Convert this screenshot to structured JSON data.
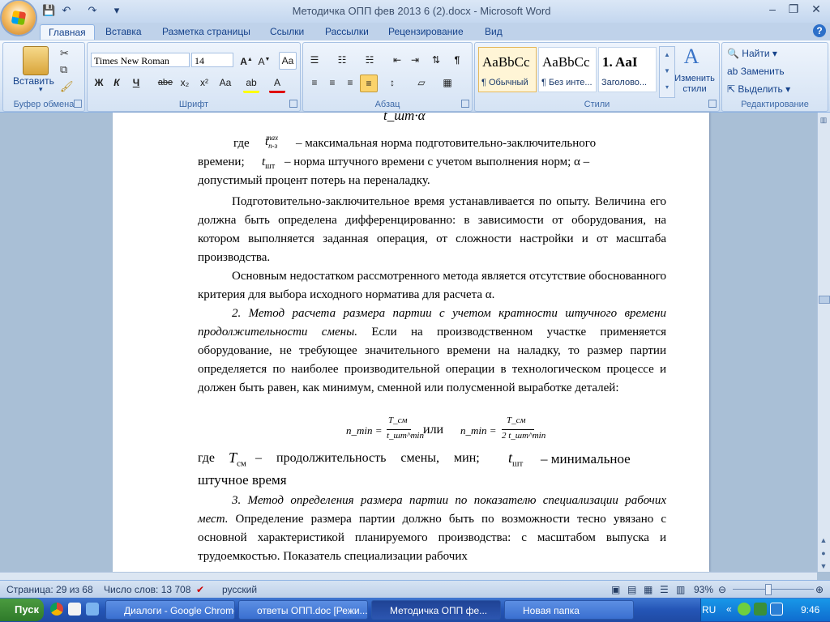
{
  "window": {
    "title": "Методичка ОПП фев 2013 6 (2).docx - Microsoft Word"
  },
  "tabs": [
    "Главная",
    "Вставка",
    "Разметка страницы",
    "Ссылки",
    "Рассылки",
    "Рецензирование",
    "Вид"
  ],
  "ribbon": {
    "clipboard": {
      "paste": "Вставить",
      "label": "Буфер обмена"
    },
    "font": {
      "name": "Times New Roman",
      "size": "14",
      "label": "Шрифт",
      "bold": "Ж",
      "italic": "К",
      "underline": "Ч",
      "strike": "abe",
      "sub": "x₂",
      "sup": "x²",
      "case": "Aa"
    },
    "paragraph": {
      "label": "Абзац"
    },
    "styles": {
      "label": "Стили",
      "items": [
        {
          "preview": "AaBbCc",
          "name": "¶ Обычный"
        },
        {
          "preview": "AaBbCc",
          "name": "¶ Без инте..."
        },
        {
          "preview": "1. AaI",
          "name": "Заголово..."
        }
      ],
      "change": "Изменить стили"
    },
    "editing": {
      "label": "Редактирование",
      "find": "Найти",
      "replace": "Заменить",
      "select": "Выделить"
    }
  },
  "document": {
    "top_formula": "t_шт·α",
    "line1": "где",
    "line1b": "– максимальная норма подготовительно-заключительного",
    "line2": "времени;",
    "line2b": "– норма штучного времени с учетом выполнения норм; α –",
    "line3": "допустимый процент потерь на переналадку.",
    "para2": "Подготовительно-заключительное время устанавливается по опыту. Величина его должна быть определена дифференцированно: в зависимости от оборудования, на котором выполняется заданная операция, от сложности настройки и от масштаба производства.",
    "para3": "Основным недостатком рассмотренного метода является отсутствие обоснованного критерия для выбора исходного норматива для расчета α.",
    "para4_italic": "2. Метод расчета размера партии с учетом кратности штучного времени продолжительности смены.",
    "para4_rest": "Если на производственном участке применяется оборудование, не требующее значительного времени на наладку, то размер партии определяется по наиболее производительной операции в технологическом процессе и должен быть равен, как минимум, сменной или полусменной выработке деталей:",
    "formula_or": "или",
    "formula_left": "n_min =",
    "formula_frac1_num": "T_см",
    "formula_frac1_den": "t_шт^min",
    "formula_right": "n_min =",
    "formula_frac2_num": "T_см",
    "formula_frac2_den": "2 t_шт^min",
    "where2": "где",
    "where2_a": "– продолжительность смены, мин;",
    "where2_b": "– минимальное",
    "where2_c": "штучное время",
    "para5_italic": "3. Метод определения размера партии по показателю специализации рабочих мест.",
    "para5_rest": "Определение размера партии должно быть по возможности тесно увязано с основной характеристикой планируемого производства: с масштабом выпуска и трудоемкостью. Показатель специализации рабочих"
  },
  "statusbar": {
    "page": "Страница: 29 из 68",
    "words": "Число слов: 13 708",
    "lang": "русский",
    "zoom": "93%"
  },
  "taskbar": {
    "start": "Пуск",
    "tasks": [
      "Диалоги - Google Chrome",
      "ответы ОПП.doc [Режи...",
      "Методичка ОПП фе...",
      "Новая папка"
    ],
    "lang": "RU",
    "time": "9:46"
  }
}
